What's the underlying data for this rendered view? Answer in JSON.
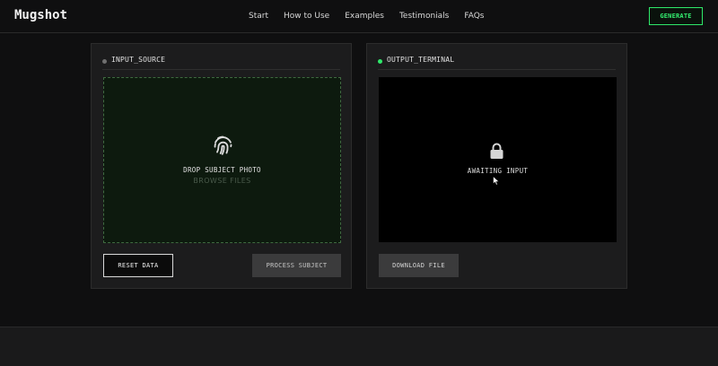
{
  "header": {
    "logo": "Mugshot",
    "nav": [
      "Start",
      "How to Use",
      "Examples",
      "Testimonials",
      "FAQs"
    ],
    "cta_label": "GENERATE"
  },
  "input_panel": {
    "title": "INPUT_SOURCE",
    "drop_text": "DROP SUBJECT PHOTO",
    "browse_text": "BROWSE FILES",
    "reset_label": "RESET DATA",
    "process_label": "PROCESS SUBJECT",
    "icon": "fingerprint-icon"
  },
  "output_panel": {
    "title": "OUTPUT_TERMINAL",
    "status_text": "AWAITING INPUT",
    "download_label": "DOWNLOAD FILE",
    "icon": "lock-icon"
  },
  "colors": {
    "accent": "#2fe86a",
    "background": "#0f0f10",
    "panel": "#1c1c1d"
  }
}
